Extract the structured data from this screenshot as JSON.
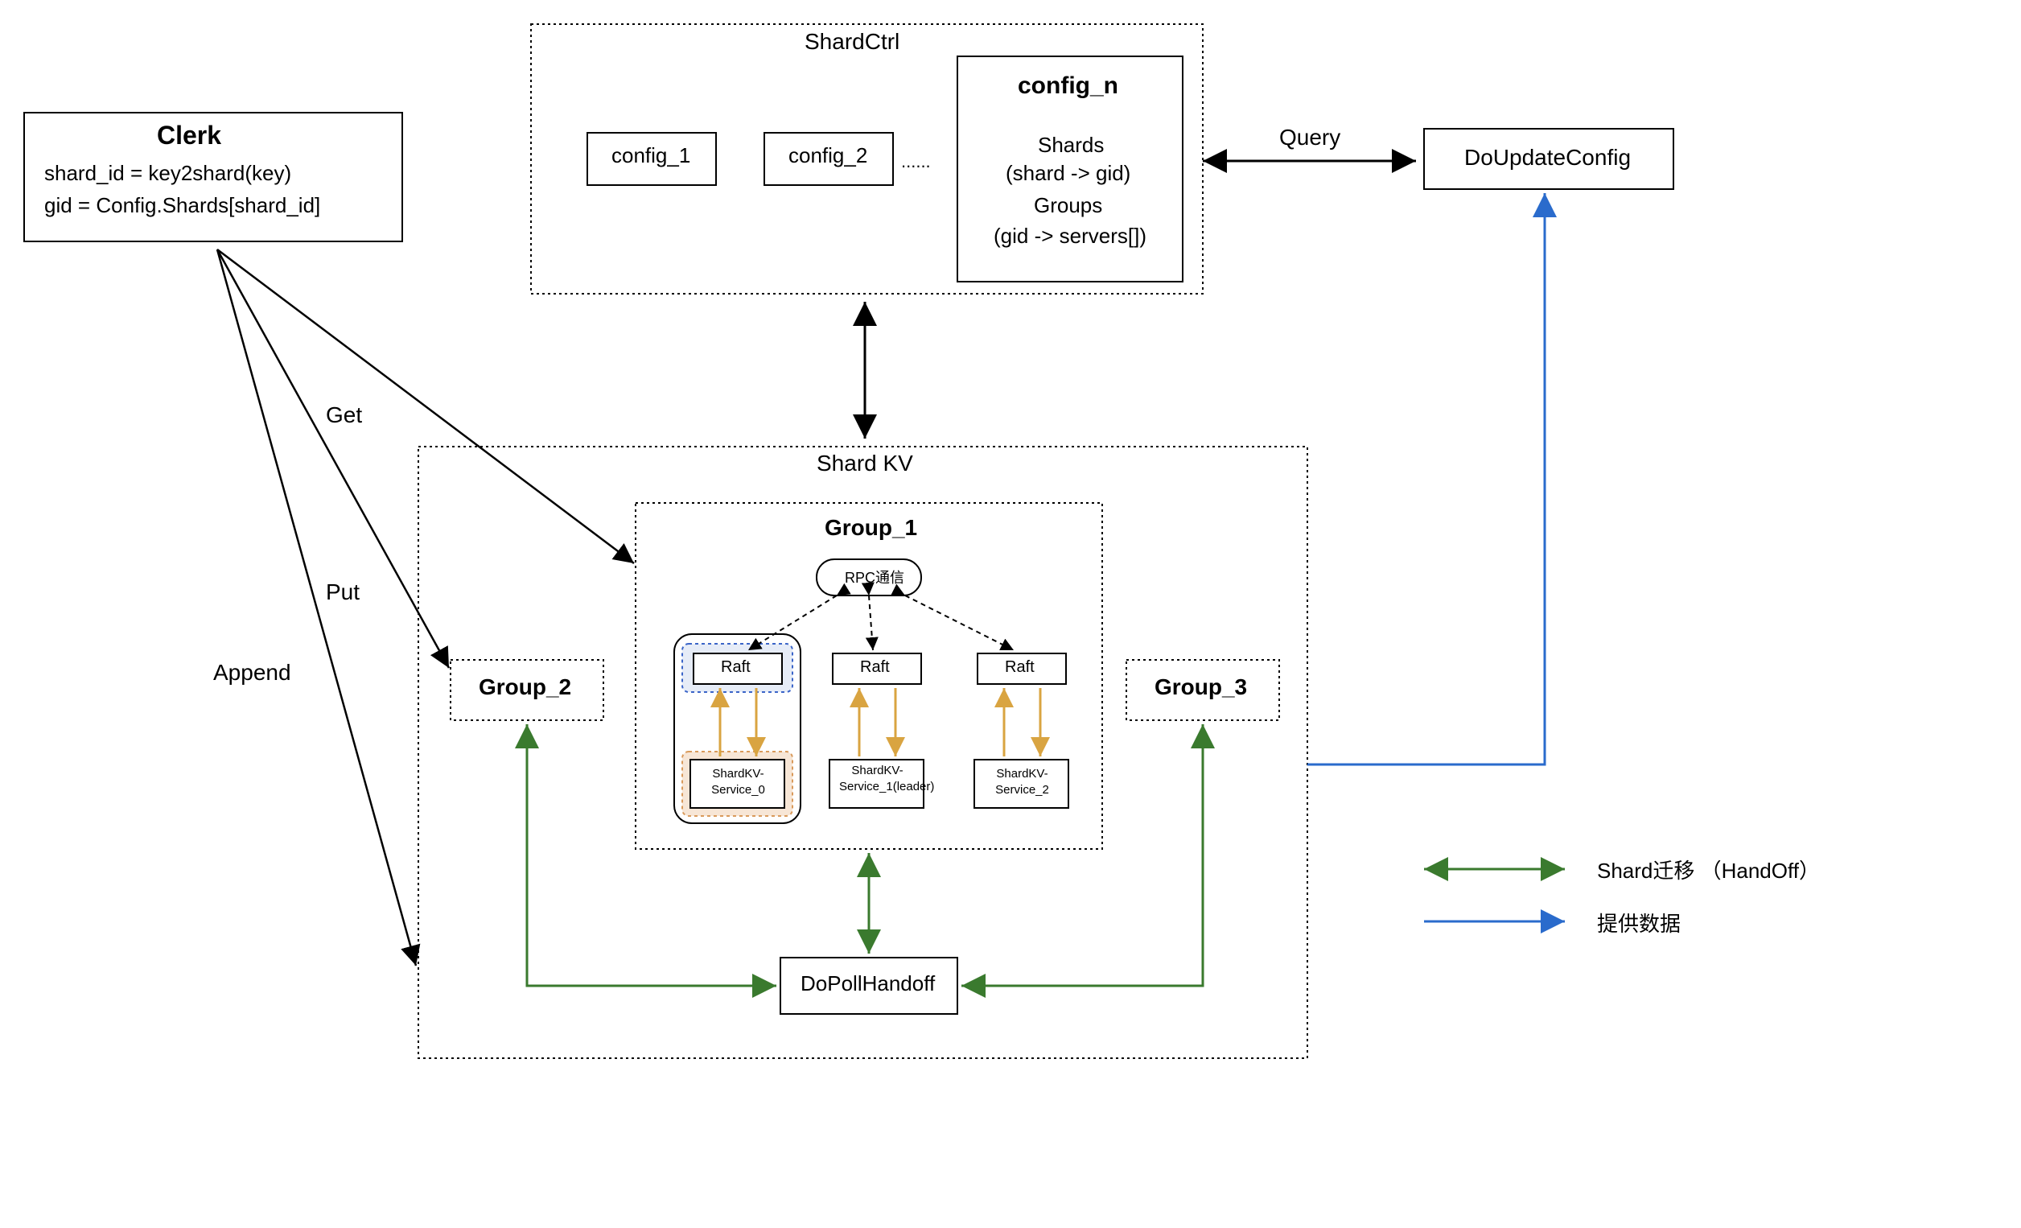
{
  "clerk": {
    "title": "Clerk",
    "line1": "shard_id = key2shard(key)",
    "line2": "gid = Config.Shards[shard_id]"
  },
  "shardctrl": {
    "title": "ShardCtrl",
    "config1": "config_1",
    "config2": "config_2",
    "dots": "......",
    "config_n": {
      "title": "config_n",
      "line1": "Shards",
      "line2": "(shard -> gid)",
      "line3": "Groups",
      "line4": "(gid -> servers[])"
    }
  },
  "doupdate": "DoUpdateConfig",
  "query_label": "Query",
  "ops": {
    "get": "Get",
    "put": "Put",
    "append": "Append"
  },
  "shardkv": {
    "title": "Shard KV",
    "group2": "Group_2",
    "group3": "Group_3",
    "group1": {
      "title": "Group_1",
      "rpc": "RPC通信",
      "raft0": "Raft",
      "raft1": "Raft",
      "raft2": "Raft",
      "svc0": "ShardKV-Service_0",
      "svc1": "ShardKV-Service_1(leader)",
      "svc2": "ShardKV-Service_2"
    },
    "handoff": "DoPollHandoff"
  },
  "legend": {
    "shard_migration": "Shard迁移 （HandOff）",
    "provide_data": "提供数据"
  },
  "colors": {
    "green": "#3a7a2e",
    "blue": "#2a6bcc",
    "orange": "#d9a441",
    "black": "#000000",
    "dotted_blue": "#3a64c8",
    "shaded_orange": "#f3d7c1"
  }
}
